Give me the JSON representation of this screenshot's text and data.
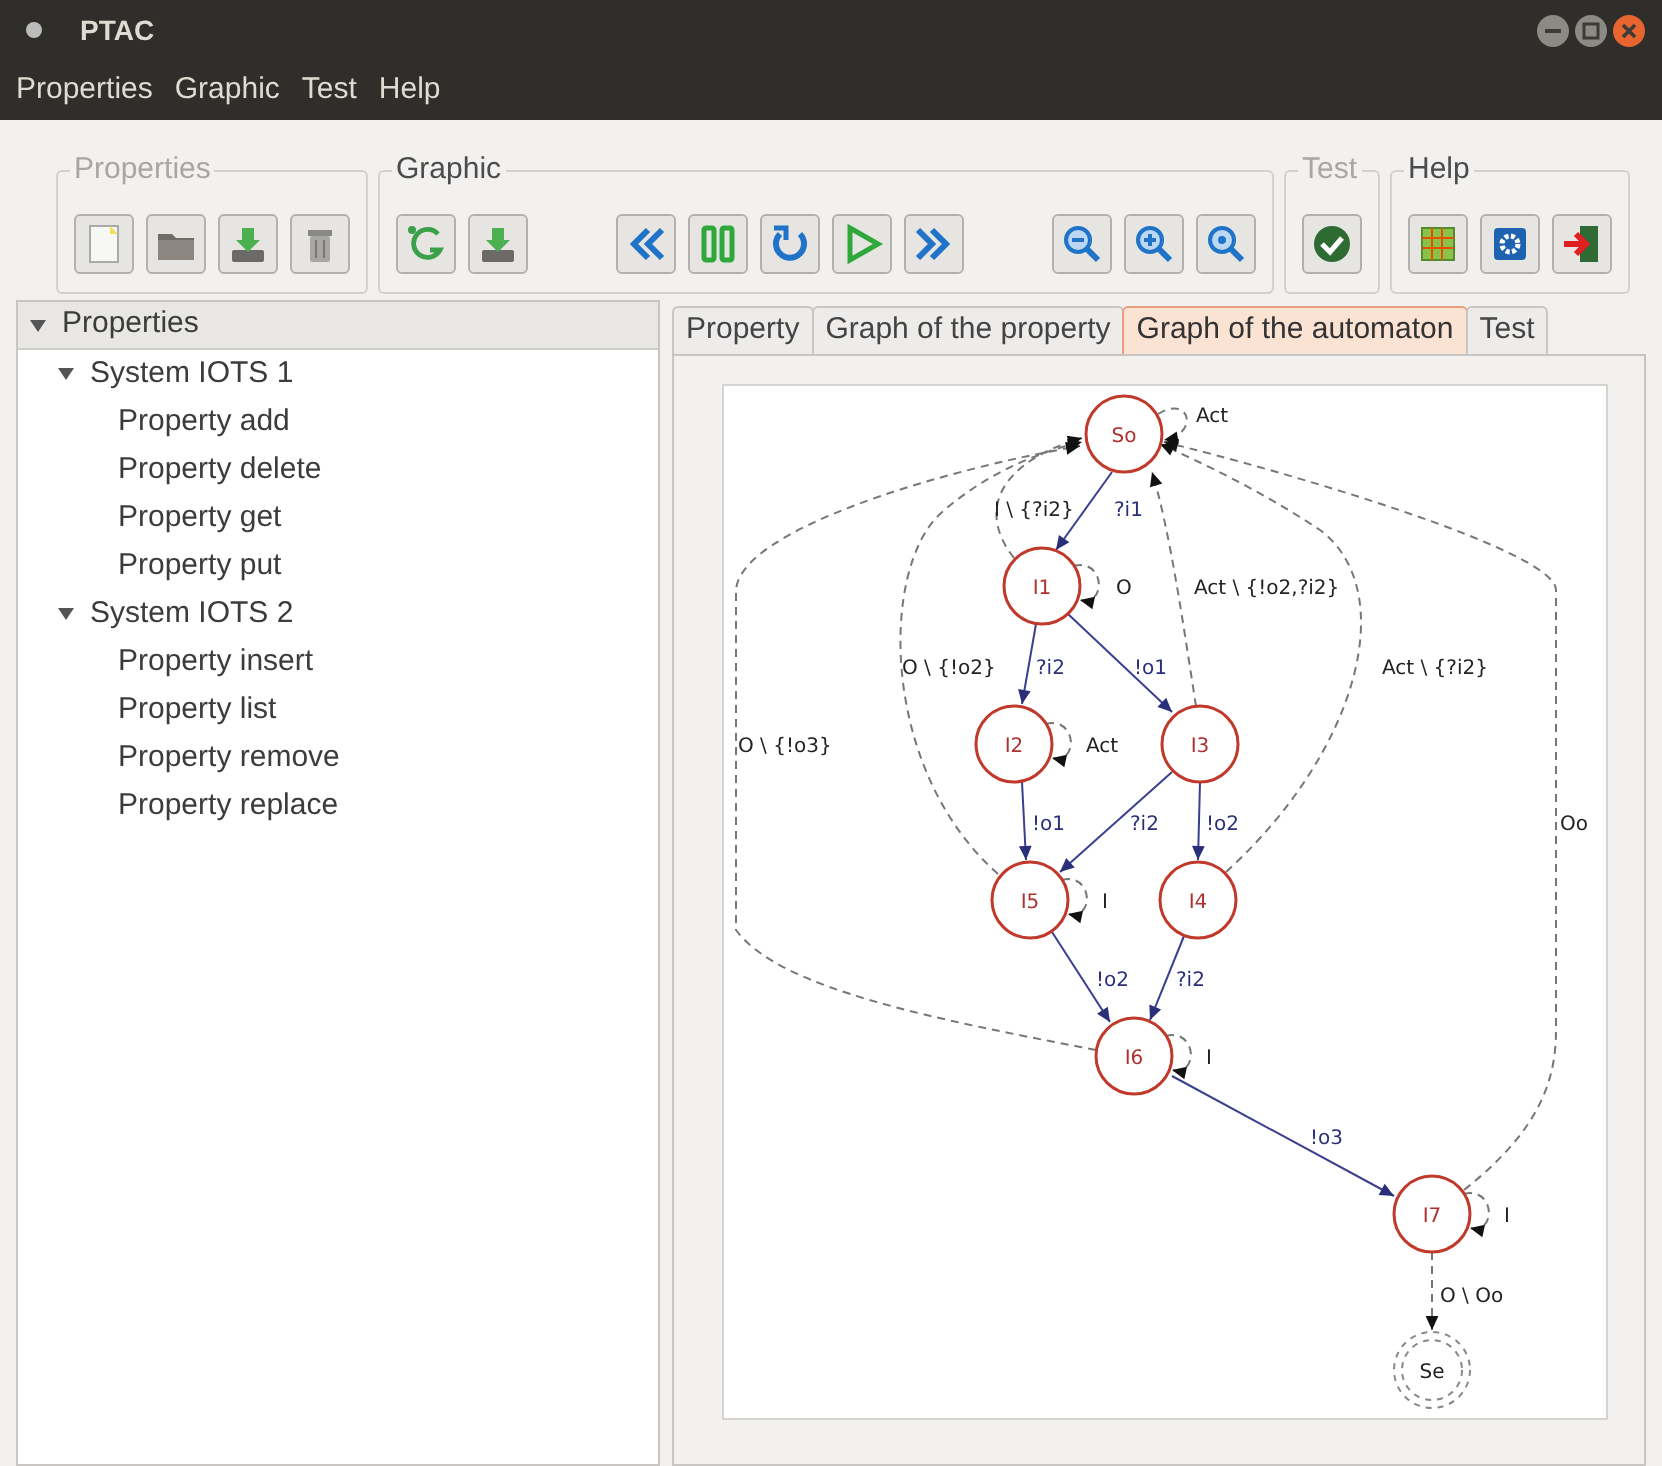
{
  "window": {
    "title": "PTAC"
  },
  "menu": [
    "Properties",
    "Graphic",
    "Test",
    "Help"
  ],
  "toolbar_groups": [
    {
      "label": "Properties",
      "disabled": true
    },
    {
      "label": "Graphic",
      "disabled": false
    },
    {
      "label": "Test",
      "disabled": true
    },
    {
      "label": "Help",
      "disabled": false
    }
  ],
  "tree": [
    {
      "label": "Properties",
      "expanded": true,
      "children": [
        {
          "label": "System IOTS 1",
          "expanded": true,
          "children": [
            {
              "label": "Property add"
            },
            {
              "label": "Property delete"
            },
            {
              "label": "Property get"
            },
            {
              "label": "Property put"
            }
          ]
        },
        {
          "label": "System IOTS 2",
          "expanded": true,
          "children": [
            {
              "label": "Property insert"
            },
            {
              "label": "Property list"
            },
            {
              "label": "Property remove"
            },
            {
              "label": "Property replace"
            }
          ]
        }
      ]
    }
  ],
  "tabs": [
    {
      "label": "Property",
      "selected": false
    },
    {
      "label": "Graph of the property",
      "selected": false
    },
    {
      "label": "Graph of the automaton",
      "selected": true
    },
    {
      "label": "Test",
      "selected": false
    }
  ],
  "graph": {
    "states": [
      {
        "label": "So",
        "kind": "state"
      },
      {
        "label": "I1",
        "kind": "state"
      },
      {
        "label": "I2",
        "kind": "state"
      },
      {
        "label": "I3",
        "kind": "state"
      },
      {
        "label": "I5",
        "kind": "state"
      },
      {
        "label": "I4",
        "kind": "state"
      },
      {
        "label": "I6",
        "kind": "state"
      },
      {
        "label": "I7",
        "kind": "state"
      },
      {
        "label": "Se",
        "kind": "final"
      }
    ],
    "transitions": [
      {
        "label": "Act",
        "kind": "dashed"
      },
      {
        "label": "?i1",
        "kind": "solid"
      },
      {
        "label": "I \\ {?i2}",
        "kind": "dashed"
      },
      {
        "label": "O",
        "kind": "dashed"
      },
      {
        "label": "Act \\ {!o2,?i2}",
        "kind": "dashed"
      },
      {
        "label": "O \\ {!o2}",
        "kind": "dashed"
      },
      {
        "label": "?i2",
        "kind": "solid"
      },
      {
        "label": "!o1",
        "kind": "solid"
      },
      {
        "label": "Act \\ {?i2}",
        "kind": "dashed"
      },
      {
        "label": "Act",
        "kind": "dashed"
      },
      {
        "label": "O \\ {!o3}",
        "kind": "dashed"
      },
      {
        "label": "!o1",
        "kind": "solid"
      },
      {
        "label": "?i2",
        "kind": "solid"
      },
      {
        "label": "!o2",
        "kind": "solid"
      },
      {
        "label": "Oo",
        "kind": "dashed"
      },
      {
        "label": "I",
        "kind": "dashed"
      },
      {
        "label": "!o2",
        "kind": "solid"
      },
      {
        "label": "?i2",
        "kind": "solid"
      },
      {
        "label": "I",
        "kind": "dashed"
      },
      {
        "label": "!o3",
        "kind": "solid"
      },
      {
        "label": "I",
        "kind": "dashed"
      },
      {
        "label": "O \\ Oo",
        "kind": "dashed"
      }
    ]
  }
}
